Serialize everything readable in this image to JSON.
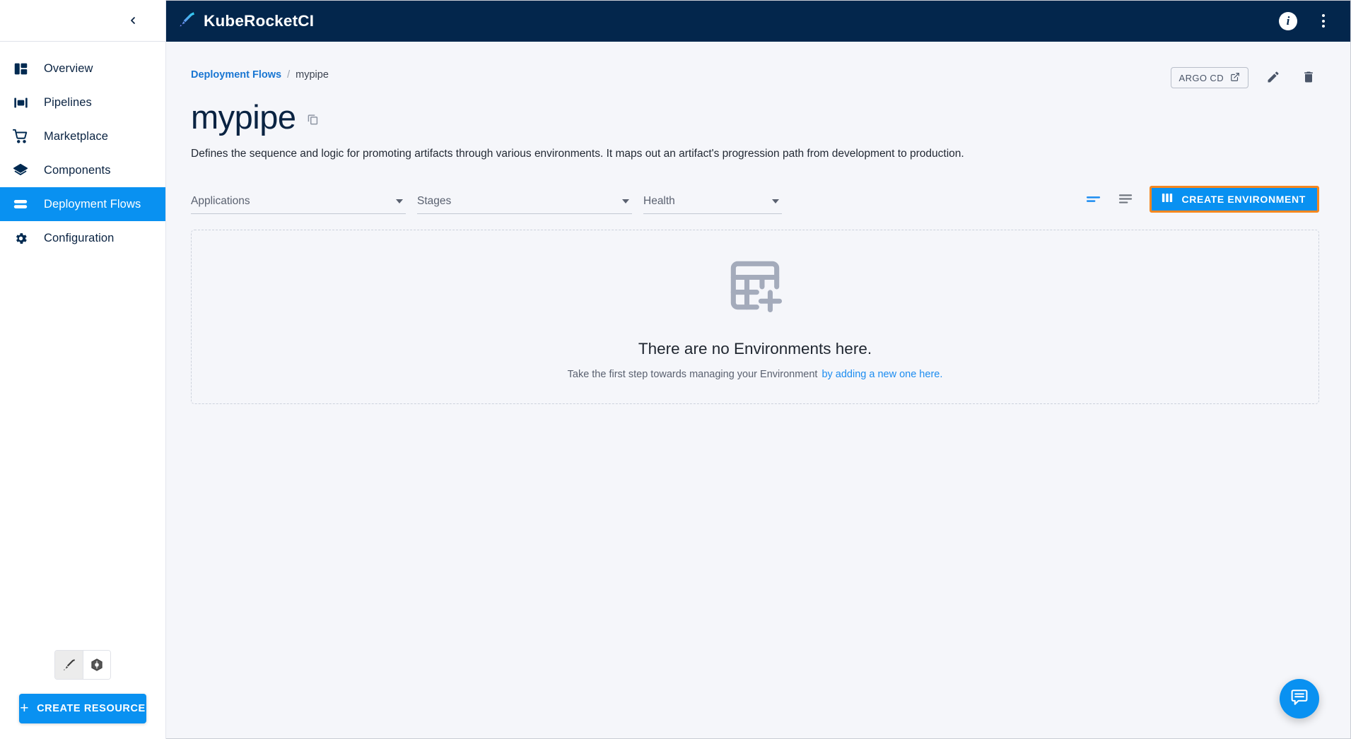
{
  "app": {
    "brand_name": "KubeRocketCI",
    "brand_icon": "rocket-pen-icon"
  },
  "sidebar": {
    "collapse_icon": "chevron-left-icon",
    "items": [
      {
        "label": "Overview",
        "icon": "dashboard-icon",
        "active": false
      },
      {
        "label": "Pipelines",
        "icon": "pipelines-icon",
        "active": false
      },
      {
        "label": "Marketplace",
        "icon": "cart-icon",
        "active": false
      },
      {
        "label": "Components",
        "icon": "layers-icon",
        "active": false
      },
      {
        "label": "Deployment Flows",
        "icon": "flows-icon",
        "active": true
      },
      {
        "label": "Configuration",
        "icon": "gear-icon",
        "active": false
      }
    ],
    "toggles": [
      {
        "icon": "krci-pen-icon",
        "selected": true
      },
      {
        "icon": "kubernetes-icon",
        "selected": false
      }
    ],
    "create_resource_label": "CREATE RESOURCE",
    "create_resource_icon": "plus-icon"
  },
  "topbar": {
    "info_icon": "info-icon",
    "info_glyph": "i",
    "menu_icon": "kebab-menu-icon"
  },
  "breadcrumb": {
    "root": "Deployment Flows",
    "separator": "/",
    "current": "mypipe"
  },
  "header_actions": {
    "argo_cd_label": "ARGO CD",
    "argo_cd_icon": "external-link-icon",
    "edit_icon": "pencil-icon",
    "delete_icon": "trash-icon"
  },
  "page": {
    "title": "mypipe",
    "copy_icon": "copy-icon",
    "description": "Defines the sequence and logic for promoting artifacts through various environments. It maps out an artifact's progression path from development to production."
  },
  "filters": [
    {
      "label": "Applications",
      "name": "applications"
    },
    {
      "label": "Stages",
      "name": "stages"
    },
    {
      "label": "Health",
      "name": "health"
    }
  ],
  "view_toggles": [
    {
      "icon": "filter-active-icon",
      "active": true
    },
    {
      "icon": "sort-lines-icon",
      "active": false
    }
  ],
  "primary_action": {
    "label": "CREATE ENVIRONMENT",
    "icon": "columns-icon",
    "background": "#0991f1",
    "highlight_border": "#f5871f"
  },
  "empty_state": {
    "icon": "add-table-icon",
    "title": "There are no Environments here.",
    "subtitle": "Take the first step towards managing your Environment",
    "link": "by adding a new one here."
  },
  "chat": {
    "icon": "chat-bubble-icon"
  },
  "colors": {
    "accent": "#0991f1",
    "topbar": "#03264c",
    "background": "#f5f6fa",
    "link": "#1976d2",
    "highlight": "#f5871f"
  }
}
